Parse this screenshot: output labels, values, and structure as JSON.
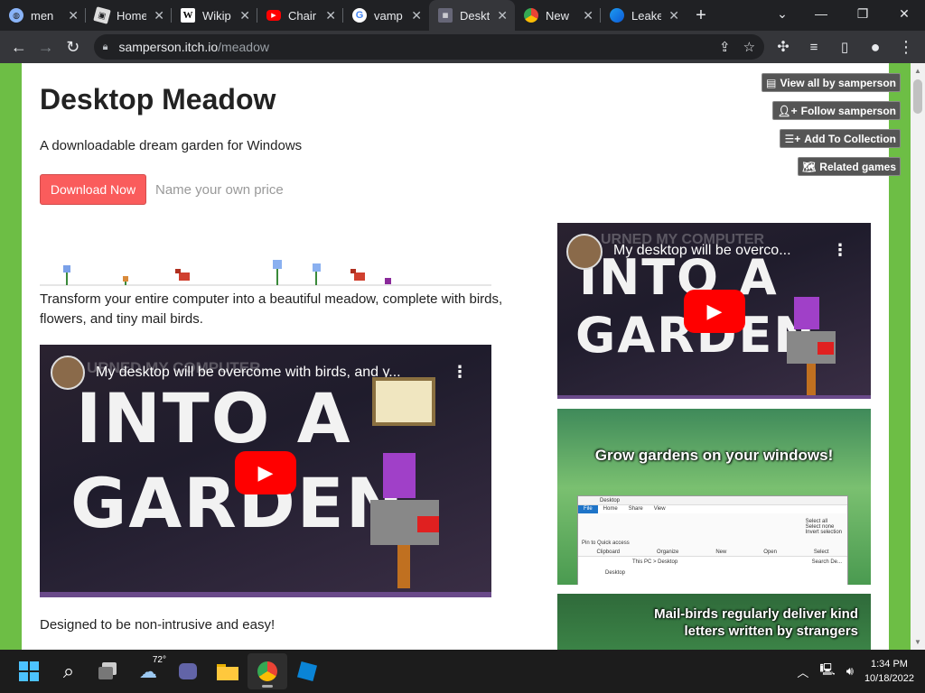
{
  "browser": {
    "tabs": [
      {
        "title": "men",
        "favicon": "globe-icon",
        "active": false
      },
      {
        "title": "Home",
        "favicon": "roblox-icon",
        "active": false
      },
      {
        "title": "Wikip",
        "favicon": "wikipedia-icon",
        "active": false
      },
      {
        "title": "Chair",
        "favicon": "youtube-icon",
        "active": false
      },
      {
        "title": "vamp",
        "favicon": "google-icon",
        "active": false
      },
      {
        "title": "Deskt",
        "favicon": "itchio-icon",
        "active": true
      },
      {
        "title": "New",
        "favicon": "chrome-icon",
        "active": false
      },
      {
        "title": "Leake",
        "favicon": "edge-icon",
        "active": false
      }
    ],
    "close_glyph": "✕",
    "new_tab_glyph": "+",
    "url_host": "samperson.itch.io",
    "url_path": "/meadow"
  },
  "page": {
    "title": "Desktop Meadow",
    "tagline": "A downloadable dream garden for Windows",
    "download_label": "Download Now",
    "price_label": "Name your own price",
    "description": "Transform your entire computer into a beautiful meadow, complete with birds, flowers, and tiny mail birds.",
    "note": "Designed to be non-intrusive and easy!",
    "side_buttons": [
      {
        "label": "View all by samperson",
        "icon": "library-icon"
      },
      {
        "label": "Follow samperson",
        "icon": "add-user-icon"
      },
      {
        "label": "Add To Collection",
        "icon": "add-list-icon"
      },
      {
        "label": "Related games",
        "icon": "map-icon"
      }
    ],
    "main_video": {
      "title": "My desktop will be overcome with birds, and y...",
      "big_line1": "INTO A",
      "big_line2": "GARDEN",
      "ghost": "URNED MY COMPUTER"
    },
    "side_video": {
      "title": "My desktop will be overco...",
      "big_line1": "INTO A",
      "big_line2": "GARDEN",
      "ghost": "URNED MY COMPUTER"
    },
    "screenshot1_caption": "Grow gardens on your windows!",
    "screenshot1_explorer": {
      "ribbon_tabs": [
        "File",
        "Home",
        "Share",
        "View"
      ],
      "address": "This PC  >  Desktop",
      "search": "Search De...",
      "nav_item": "Desktop",
      "groups": [
        "Clipboard",
        "Organize",
        "New",
        "Open",
        "Select"
      ],
      "select_items": [
        "Select all",
        "Select none",
        "Invert selection"
      ],
      "pin_label": "Pin to Quick access",
      "window_title": "Desktop"
    },
    "screenshot2_caption_line1": "Mail-birds regularly deliver kind",
    "screenshot2_caption_line2": "letters written by strangers"
  },
  "taskbar": {
    "weather_temp": "72°",
    "time": "1:34 PM",
    "date": "10/18/2022"
  },
  "colors": {
    "page_border": "#6dbe45",
    "download_button": "#fa5c5c",
    "play_button": "#ff0000"
  }
}
